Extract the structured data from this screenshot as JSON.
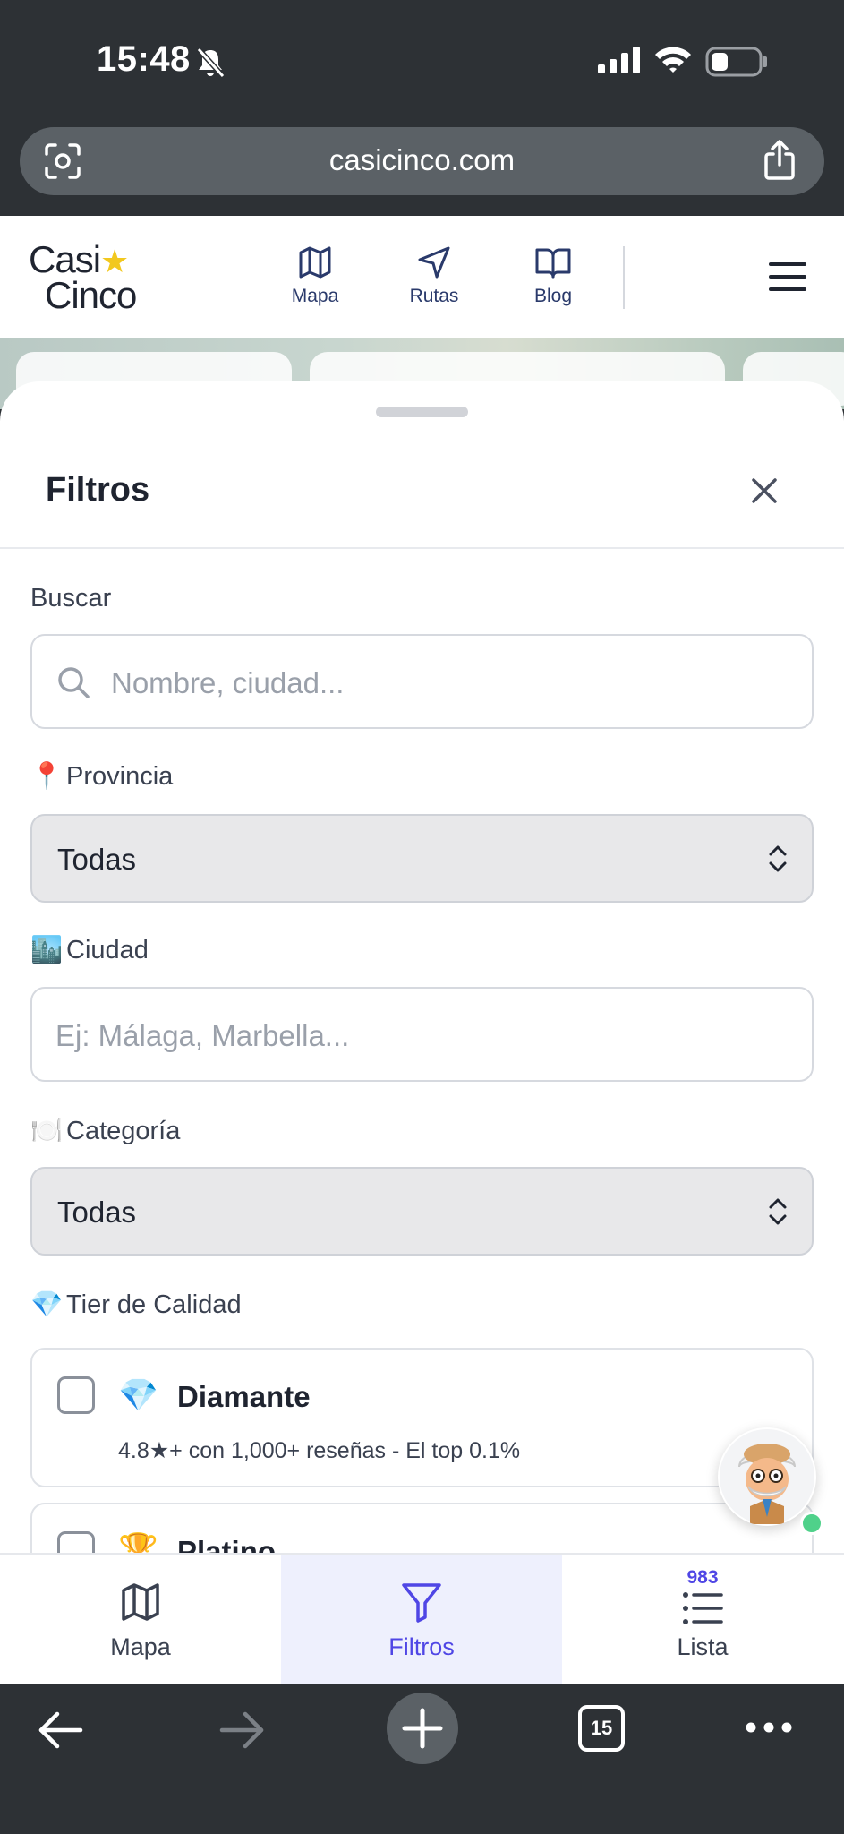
{
  "status_bar": {
    "time": "15:48"
  },
  "browser": {
    "url": "casicinco.com",
    "tab_count": "15"
  },
  "site": {
    "logo_line1": "Casi",
    "logo_star": "★",
    "logo_line2": "Cinco",
    "nav": [
      {
        "label": "Mapa",
        "icon": "map-icon"
      },
      {
        "label": "Rutas",
        "icon": "navigation-arrow-icon"
      },
      {
        "label": "Blog",
        "icon": "book-open-icon"
      }
    ]
  },
  "filters": {
    "title": "Filtros",
    "search": {
      "label": "Buscar",
      "placeholder": "Nombre, ciudad..."
    },
    "province": {
      "emoji": "📍",
      "label": "Provincia",
      "value": "Todas"
    },
    "city": {
      "emoji": "🏙️",
      "label": "Ciudad",
      "placeholder": "Ej: Málaga, Marbella..."
    },
    "category": {
      "emoji": "🍽️",
      "label": "Categoría",
      "value": "Todas"
    },
    "tier": {
      "emoji": "💎",
      "label": "Tier de Calidad",
      "options": [
        {
          "emoji": "💎",
          "name": "Diamante",
          "description": "4.8★+ con 1,000+ reseñas - El top 0.1%",
          "checked": false
        },
        {
          "emoji": "🏆",
          "name": "Platino",
          "description": "",
          "checked": false
        }
      ]
    }
  },
  "bottom_tabs": [
    {
      "label": "Mapa",
      "icon": "map-icon",
      "active": false
    },
    {
      "label": "Filtros",
      "icon": "filter-icon",
      "active": true
    },
    {
      "label": "Lista",
      "icon": "list-icon",
      "active": false,
      "count": "983"
    }
  ],
  "colors": {
    "accent": "#4f46e5",
    "nav_text": "#2a3a6b",
    "logo_star": "#f2c81e",
    "chrome": "#2d3135"
  }
}
